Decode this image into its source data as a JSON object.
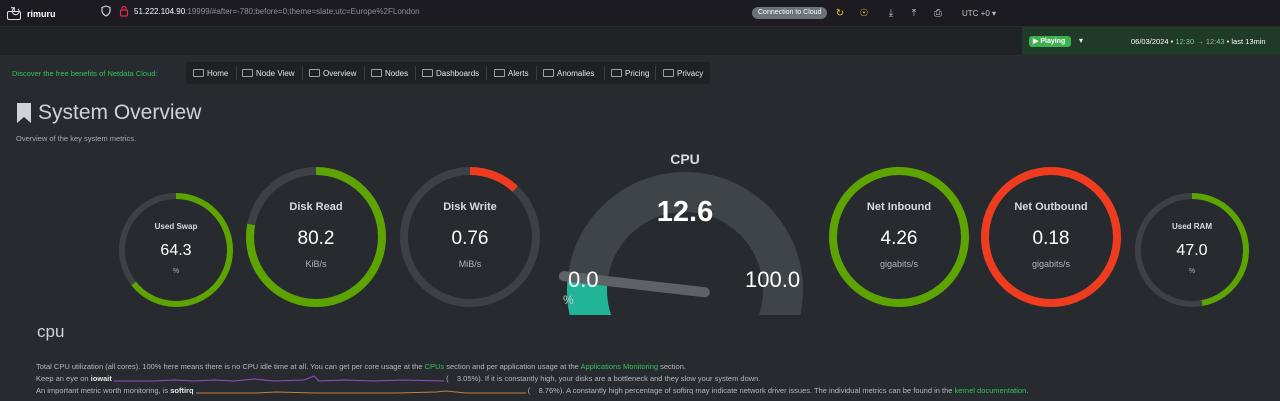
{
  "browser": {
    "url_host": "51.222.104.90",
    "url_rest": ":19999/#after=-780;before=0;theme=slate;utc=Europe%2FLondon"
  },
  "header": {
    "hostname": "rimuru",
    "cloud_button": "Connection to Cloud",
    "timezone": "UTC +0",
    "play_status": "Playing",
    "date": "06/03/2024",
    "time_from": "12:30",
    "time_to": "12:43",
    "range": "last 13min"
  },
  "nav": {
    "discover": "Discover the free benefits of Netdata Cloud:",
    "items": [
      {
        "label": "Home"
      },
      {
        "label": "Node View"
      },
      {
        "label": "Overview"
      },
      {
        "label": "Nodes"
      },
      {
        "label": "Dashboards"
      },
      {
        "label": "Alerts"
      },
      {
        "label": "Anomalies"
      },
      {
        "label": "Pricing"
      },
      {
        "label": "Privacy"
      }
    ]
  },
  "page": {
    "title": "System Overview",
    "subtitle": "Overview of the key system metrics."
  },
  "gauges": [
    {
      "label": "Used Swap",
      "value": "64.3",
      "unit": "%",
      "fraction": 0.643,
      "color": "#5ea400"
    },
    {
      "label": "Disk Read",
      "value": "80.2",
      "unit": "KiB/s",
      "fraction": 0.78,
      "color": "#5ea400"
    },
    {
      "label": "Disk Write",
      "value": "0.76",
      "unit": "MiB/s",
      "fraction": 0.12,
      "color": "#f03c1e"
    },
    {
      "label": "Net Inbound",
      "value": "4.26",
      "unit": "gigabits/s",
      "fraction": 1.0,
      "color": "#5ea400"
    },
    {
      "label": "Net Outbound",
      "value": "0.18",
      "unit": "gigabits/s",
      "fraction": 1.0,
      "color": "#f03c1e"
    },
    {
      "label": "Used RAM",
      "value": "47.0",
      "unit": "%",
      "fraction": 0.47,
      "color": "#5ea400"
    }
  ],
  "cpu_gauge": {
    "title": "CPU",
    "value": "12.6",
    "min": "0.0",
    "max": "100.0",
    "unit": "%",
    "fraction": 0.126,
    "color": "#22b59a"
  },
  "cpu_section": {
    "title": "cpu",
    "line1_a": "Total CPU utilization (all cores). 100% here means there is no CPU idle time at all. You can get per core usage at the ",
    "line1_link1": "CPUs",
    "line1_b": " section and per application usage at the ",
    "line1_link2": "Applications Monitoring",
    "line1_c": " section.",
    "line2_a": "Keep an eye on ",
    "line2_bold": "iowait",
    "line2_value": "3.05%",
    "line2_b": "). If it is constantly high, your disks are a bottleneck and they slow your system down.",
    "line3_a": "An important metric worth monitoring, is ",
    "line3_bold": "softirq",
    "line3_value": "8.76%",
    "line3_b": "). A constantly high percentage of softirq may indicate network driver issues. The individual metrics can be found in the ",
    "line3_link": "kernel documentation",
    "line3_c": "."
  }
}
